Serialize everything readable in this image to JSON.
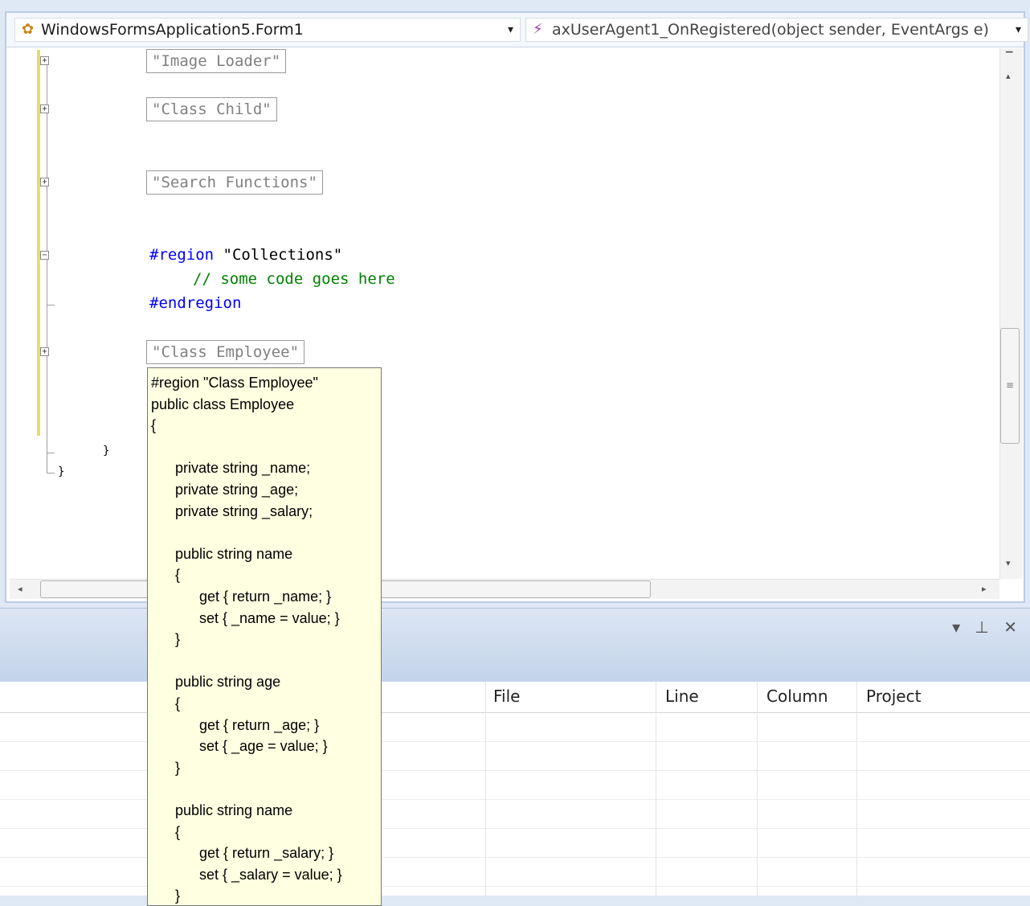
{
  "nav": {
    "class_combo": "WindowsFormsApplication5.Form1",
    "member_combo": "axUserAgent1_OnRegistered(object sender, EventArgs e)",
    "dropdown_glyph": "▾",
    "class_icon": "class-icon",
    "method_icon": "event-method-icon"
  },
  "editor": {
    "collapsed_regions": [
      "\"Image Loader\"",
      "\"Class Child\"",
      "\"Search Functions\"",
      "\"Class Employee\""
    ],
    "region_line": {
      "kw": "#region",
      "name": "\"Collections\""
    },
    "comment_line": "// some code goes here",
    "endregion_line": "#endregion",
    "brace_inner": "}",
    "brace_outer": "}",
    "outline_collapsed": "+",
    "outline_expanded": "−"
  },
  "tooltip": {
    "lines": [
      "#region \"Class Employee\"",
      "public class Employee",
      "{",
      "",
      "      private string _name;",
      "      private string _age;",
      "      private string _salary;",
      "",
      "      public string name",
      "      {",
      "            get { return _name; }",
      "            set { _name = value; }",
      "      }",
      "",
      "      public string age",
      "      {",
      "            get { return _age; }",
      "            set { _age = value; }",
      "      }",
      "",
      "      public string name",
      "      {",
      "            get { return _salary; }",
      "            set { _salary = value; }",
      "      }"
    ]
  },
  "panel": {
    "controls": "▾ ⊥ ✕",
    "columns": [
      "File",
      "Line",
      "Column",
      "Project"
    ]
  },
  "colors": {
    "keyword": "#0000ff",
    "comment": "#008000",
    "collapsed_text": "#808080",
    "tooltip_bg": "#ffffe1",
    "change_bar": "#e8db6a"
  }
}
